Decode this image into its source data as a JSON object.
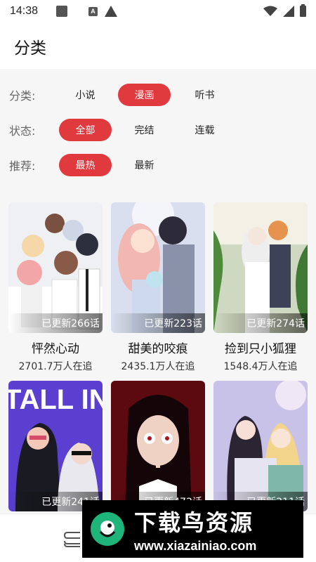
{
  "status_bar": {
    "time": "14:38",
    "notification_icons": [
      "app-square-icon",
      "a-icon",
      "warning-icon"
    ],
    "system_icons": [
      "wifi-icon",
      "signal-icon",
      "battery-icon"
    ]
  },
  "header": {
    "title": "分类"
  },
  "filters": {
    "category": {
      "label": "分类:",
      "options": [
        "小说",
        "漫画",
        "听书"
      ],
      "selected": "漫画"
    },
    "status": {
      "label": "状态:",
      "options": [
        "全部",
        "完结",
        "连载"
      ],
      "selected": "全部"
    },
    "recommend": {
      "label": "推荐:",
      "options": [
        "最热",
        "最新"
      ],
      "selected": "最热"
    }
  },
  "colors": {
    "accent": "#e0393e",
    "filter_bg": "#f6f6f6"
  },
  "comics": [
    {
      "title": "怦然心动",
      "readers": "2701.7万人在追",
      "updated": "已更新266话"
    },
    {
      "title": "甜美的咬痕",
      "readers": "2435.1万人在追",
      "updated": "已更新223话"
    },
    {
      "title": "捡到只小狐狸",
      "readers": "1548.4万人在追",
      "updated": "已更新274话"
    },
    {
      "title": "",
      "readers": "",
      "updated": "已更新241话",
      "cover_text": "TALL IN"
    },
    {
      "title": "",
      "readers": "",
      "updated": "已更新472话"
    },
    {
      "title": "",
      "readers": "",
      "updated": "已更新211话"
    }
  ],
  "bottom_nav": {
    "icons": [
      "books-icon"
    ]
  },
  "watermark": {
    "name": "下载鸟资源",
    "url": "www.xiazainiao.com"
  }
}
